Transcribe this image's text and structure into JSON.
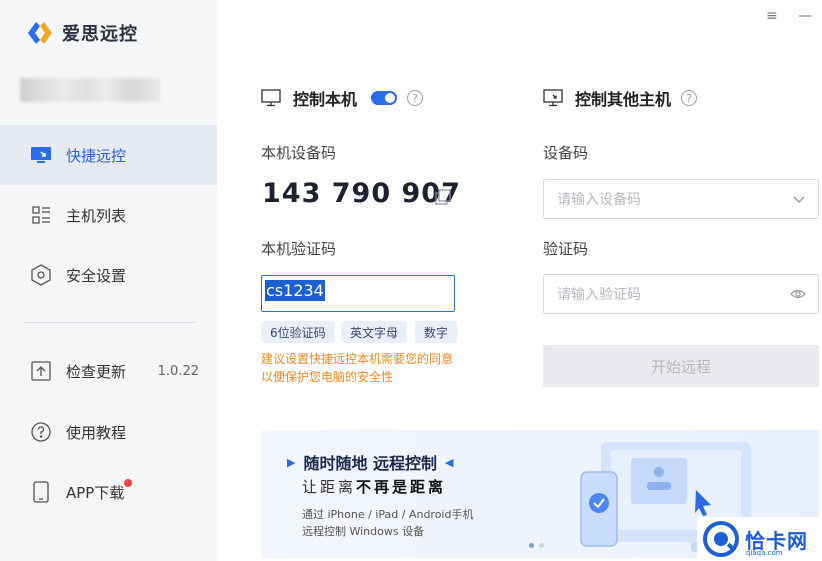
{
  "app": {
    "name": "爱思远控"
  },
  "window": {
    "menu_icon": "≡",
    "minimize_icon": "—"
  },
  "sidebar": {
    "items": [
      {
        "label": "快捷远控",
        "icon": "monitor-remote-icon",
        "active": true
      },
      {
        "label": "主机列表",
        "icon": "list-icon"
      },
      {
        "label": "安全设置",
        "icon": "shield-hex-icon"
      },
      {
        "label": "检查更新",
        "icon": "upload-icon",
        "extra": "1.0.22"
      },
      {
        "label": "使用教程",
        "icon": "question-circle-icon"
      },
      {
        "label": "APP下载",
        "icon": "phone-icon",
        "badge": true
      }
    ]
  },
  "control_local": {
    "title": "控制本机",
    "toggle_on": true,
    "device_code_label": "本机设备码",
    "device_code": "143 790 907",
    "verify_code_label": "本机验证码",
    "verify_code_value": "cs1234",
    "tags": [
      "6位验证码",
      "英文字母",
      "数字"
    ],
    "tip_line1": "建议设置快捷远控本机需要您的同意",
    "tip_line2": "以便保护您电脑的安全性"
  },
  "control_other": {
    "title": "控制其他主机",
    "device_code_label": "设备码",
    "device_code_placeholder": "请输入设备码",
    "verify_code_label": "验证码",
    "verify_code_placeholder": "请输入验证码",
    "start_button": "开始远程"
  },
  "banner": {
    "title": "随时随地 远程控制",
    "subtitle_plain": "让距离",
    "subtitle_bold": "不再是距离",
    "line1": "通过 iPhone / iPad / Android手机",
    "line2": "远程控制  Windows 设备",
    "pages": 2,
    "current_page": 1
  },
  "watermark": {
    "text": "恰卡网",
    "url": "qiaqa.com"
  },
  "colors": {
    "accent": "#2b6bea",
    "tip": "#f08a24",
    "sidebar_bg": "#f5f6f8",
    "active_bg": "#e6ebf3"
  }
}
